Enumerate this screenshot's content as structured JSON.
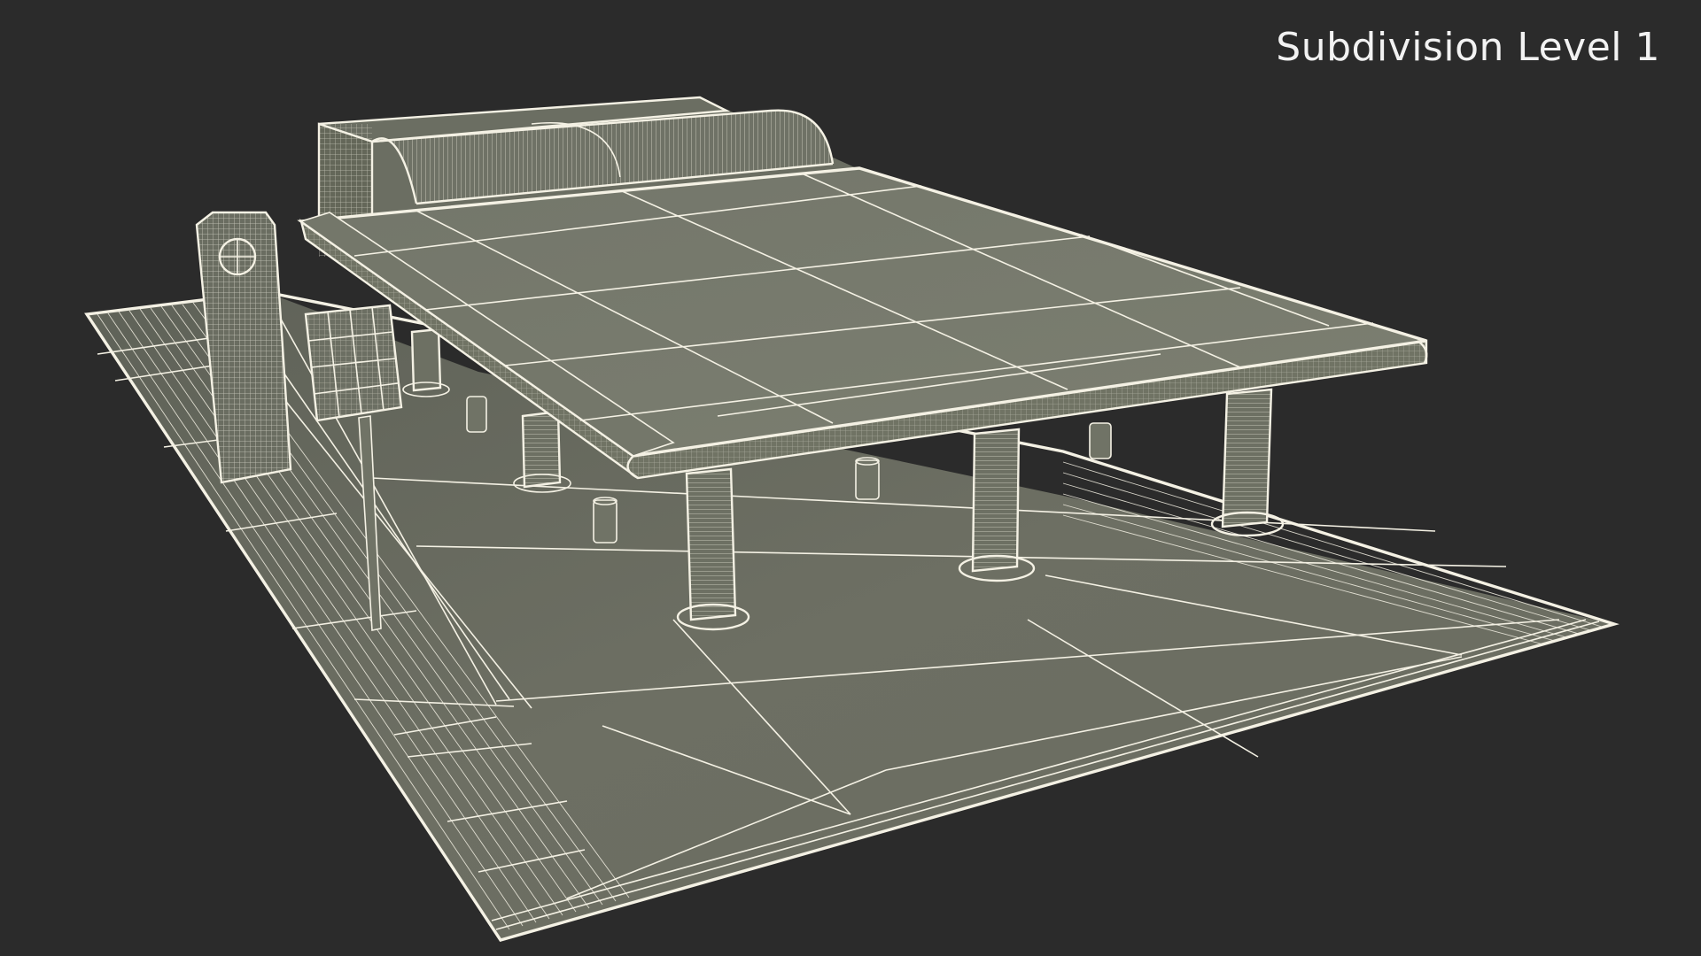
{
  "caption": {
    "text": "Subdivision Level 1"
  },
  "colors": {
    "background": "#2b2b2b",
    "surface": "#6e7064",
    "roof": "#777a6c",
    "wireframe": "#f4f1e4"
  }
}
